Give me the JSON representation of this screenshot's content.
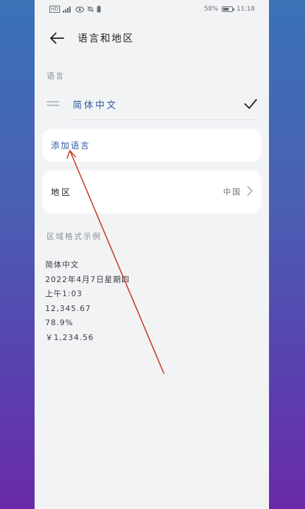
{
  "status_bar": {
    "left_icons": [
      "hd-icon",
      "signal-icon",
      "eye-icon",
      "mute-icon",
      "battery-saver-icon"
    ],
    "hd_label": "HD",
    "battery_percent": "58%",
    "battery_level": 0.58,
    "time": "11:18"
  },
  "header": {
    "title": "语言和地区"
  },
  "language_section": {
    "label": "语言",
    "languages": [
      {
        "name": "简体中文",
        "selected": true
      }
    ],
    "add_language_label": "添加语言"
  },
  "region": {
    "label": "地区",
    "value": "中国"
  },
  "format_example": {
    "label": "区域格式示例",
    "lines": [
      "简体中文",
      "2022年4月7日星期四",
      "上午1:03",
      "12,345.67",
      "78.9%",
      "￥1,234.56"
    ]
  },
  "colors": {
    "accent": "#2c5aa0",
    "annotation": "#c8402a"
  }
}
